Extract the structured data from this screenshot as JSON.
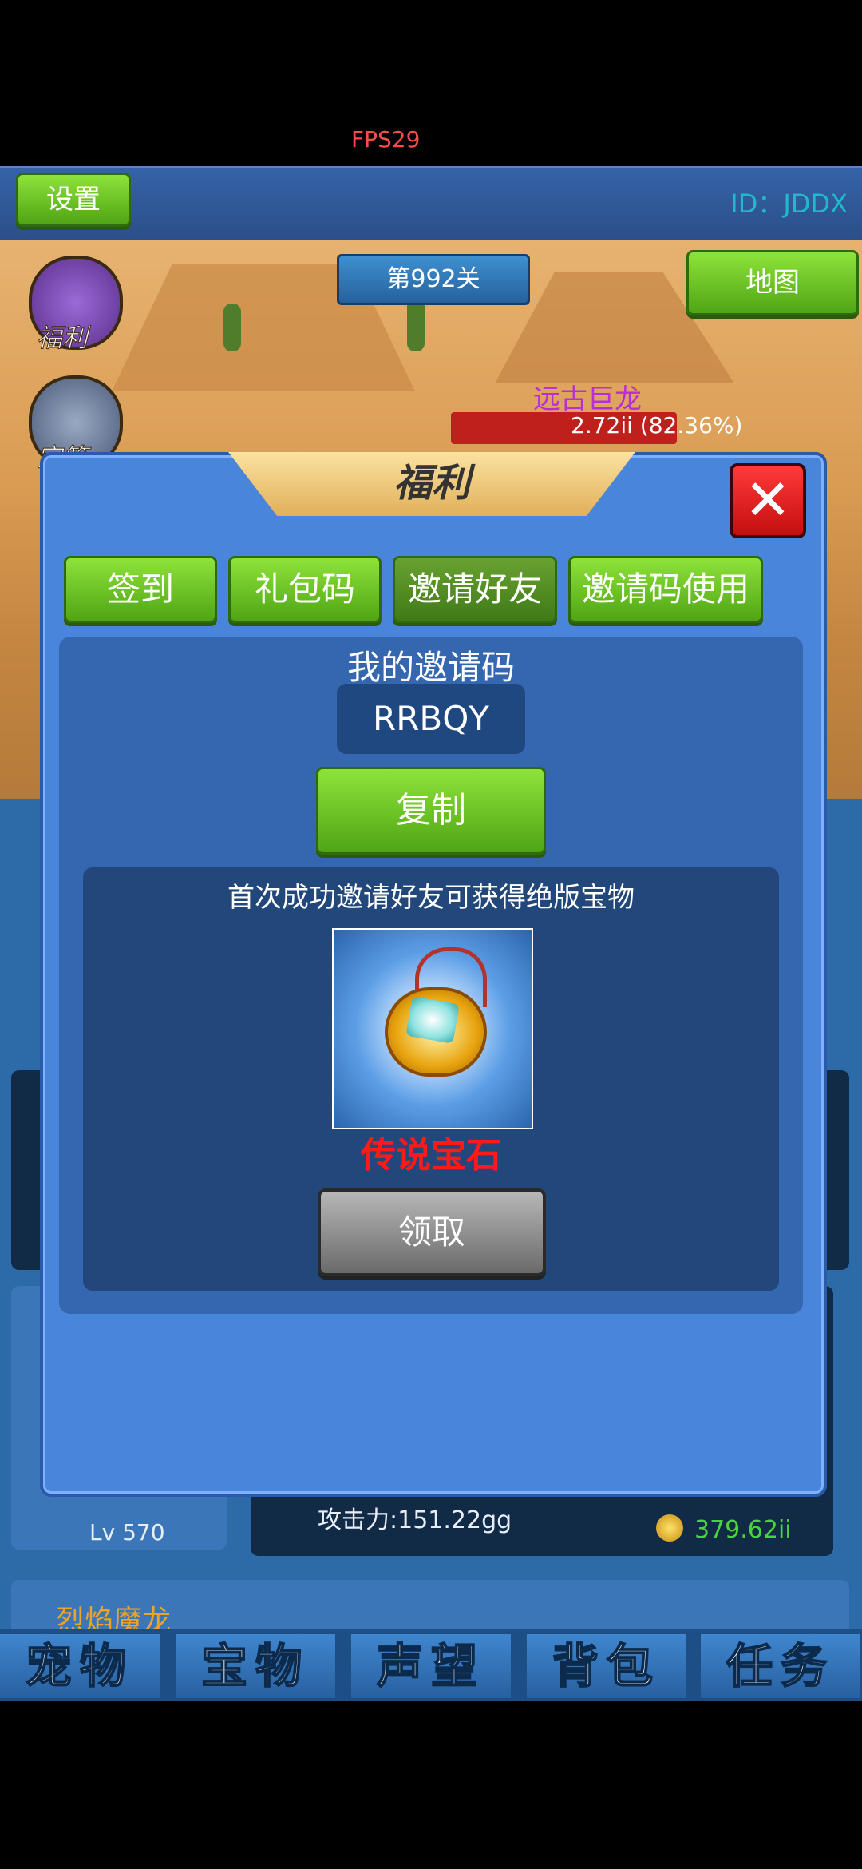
{
  "status": {
    "fps": "FPS29"
  },
  "header": {
    "settings_label": "设置",
    "user_id": "ID：JDDX"
  },
  "game": {
    "level_banner": "第992关",
    "map_label": "地图",
    "side_icons": [
      {
        "label": "福利",
        "icon": "gift-icon"
      },
      {
        "label": "宝箱",
        "icon": "chest-icon"
      }
    ],
    "boss_name": "远古巨龙",
    "boss_hp_text": "2.72ii (82.36%)",
    "boss_hp_fraction": 0.82
  },
  "background_panels": {
    "pet_level": "Lv 570",
    "attack": "攻击力:151.22gg",
    "coins": "379.62ii",
    "pet_name": "烈焰魔龙"
  },
  "bottom_tabs": [
    "宠物",
    "宝物",
    "声望",
    "背包",
    "任务"
  ],
  "modal": {
    "title": "福利",
    "close_icon": "close-icon",
    "tabs": [
      {
        "label": "签到",
        "active": false
      },
      {
        "label": "礼包码",
        "active": false
      },
      {
        "label": "邀请好友",
        "active": true
      },
      {
        "label": "邀请码使用",
        "active": false
      }
    ],
    "invite": {
      "label": "我的邀请码",
      "code": "RRBQY",
      "copy_label": "复制"
    },
    "reward": {
      "description": "首次成功邀请好友可获得绝版宝物",
      "item_name": "传说宝石",
      "claim_label": "领取"
    }
  },
  "colors": {
    "modal_bg": "#4a85dc",
    "green_button": "#6fc628",
    "reward_name": "#ff1a1a",
    "id_text": "#21b9c9"
  }
}
